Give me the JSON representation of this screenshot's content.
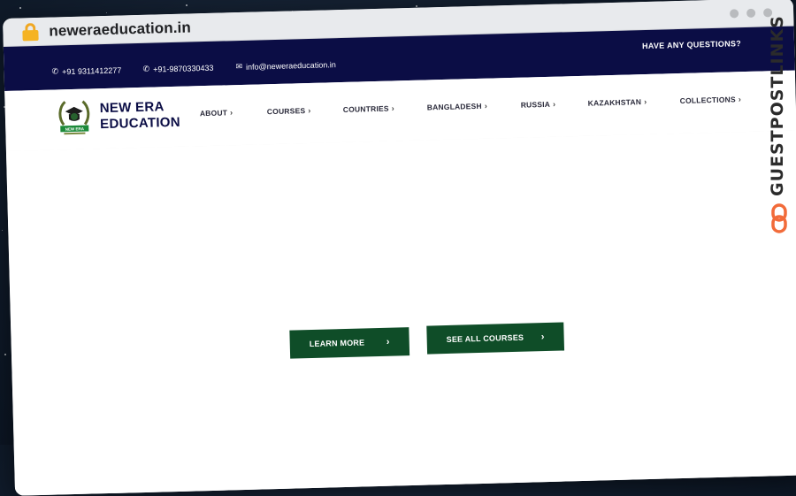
{
  "browser": {
    "url": "neweraeducation.in",
    "lock_icon": "lock-icon",
    "window_dots": [
      "dot",
      "dot",
      "dot"
    ]
  },
  "topbar": {
    "contacts": [
      {
        "icon": "phone-icon",
        "glyph": "✆",
        "text": "+91 9311412277"
      },
      {
        "icon": "phone-icon",
        "glyph": "✆",
        "text": "+91-9870330433"
      },
      {
        "icon": "mail-icon",
        "glyph": "✉",
        "text": "info@neweraeducation.in"
      }
    ],
    "questions": "HAVE ANY QUESTIONS?"
  },
  "nav": {
    "logo_line1": "NEW ERA",
    "logo_line2": "EDUCATION",
    "emblem_label": "NEW ERA",
    "menu": [
      {
        "label": "ABOUT"
      },
      {
        "label": "COURSES"
      },
      {
        "label": "COUNTRIES"
      },
      {
        "label": "BANGLADESH"
      },
      {
        "label": "RUSSIA"
      },
      {
        "label": "KAZAKHSTAN"
      },
      {
        "label": "COLLECTIONS"
      }
    ],
    "chevron": "›"
  },
  "hero": {
    "learn_more": "LEARN MORE",
    "see_all_courses": "SEE ALL COURSES",
    "chevron": "›"
  },
  "watermark": {
    "text": "GUESTPOSTLINKS"
  },
  "colors": {
    "topbar": "#0b0d45",
    "button": "#0f4d28",
    "lock": "#f5b323",
    "watermark_icon": "#f26b3a"
  }
}
